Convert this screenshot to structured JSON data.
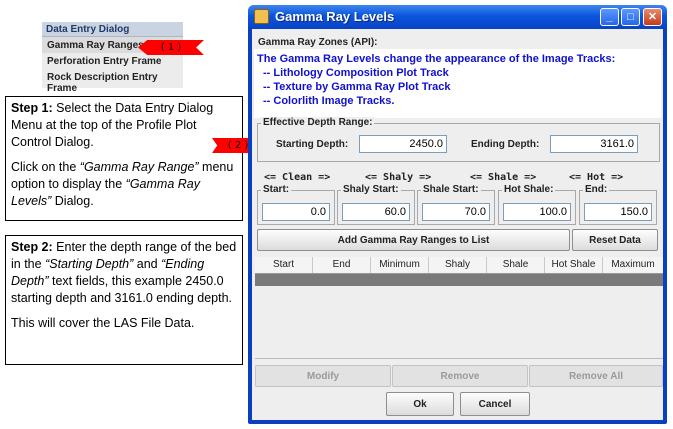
{
  "menu": {
    "header": "Data Entry Dialog",
    "items": [
      "Gamma Ray Ranges",
      "Perforation Entry Frame",
      "Rock Description Entry Frame"
    ]
  },
  "callouts": {
    "one": "( 1 )",
    "two": "( 2 )"
  },
  "step1": {
    "bold": "Step 1:",
    "text": " Select the Data Entry Dialog Menu at the top of the Profile Plot Control Dialog.",
    "p2a": "Click on the ",
    "p2i": "“Gamma Ray Range”",
    "p2b": " menu option to display the ",
    "p2i2": "“Gamma Ray Levels”",
    "p2c": " Dialog."
  },
  "step2": {
    "bold": "Step 2:",
    "a": " Enter the depth range of the bed in the ",
    "i1": "“Starting Depth”",
    "b": " and ",
    "i2": "“Ending Depth”",
    "c": " text fields, this example 2450.0 starting depth and 3161.0  ending depth.",
    "p2": "This will cover the LAS File Data."
  },
  "window": {
    "title": "Gamma Ray Levels",
    "zones": {
      "title": "Gamma Ray Zones (API):",
      "lines": [
        "The Gamma Ray Levels change the appearance of the Image Tracks:",
        "-- Lithology Composition Plot Track",
        "-- Texture by Gamma Ray Plot Track",
        "-- Colorlith Image Tracks."
      ]
    },
    "depth": {
      "title": "Effective Depth Range:",
      "start_label": "Starting Depth:",
      "start_value": "2450.0",
      "end_label": "Ending Depth:",
      "end_value": "3161.0"
    },
    "scale": [
      "<= Clean =>",
      "<= Shaly =>",
      "<= Shale =>",
      "<= Hot =>"
    ],
    "levels": [
      {
        "label": "Start:",
        "value": "0.0"
      },
      {
        "label": "Shaly Start:",
        "value": "60.0"
      },
      {
        "label": "Shale Start:",
        "value": "70.0"
      },
      {
        "label": "Hot Shale:",
        "value": "100.0"
      },
      {
        "label": "End:",
        "value": "150.0"
      }
    ],
    "buttons": {
      "add": "Add Gamma Ray Ranges to List",
      "reset": "Reset Data",
      "modify": "Modify",
      "remove": "Remove",
      "remove_all": "Remove All",
      "ok": "Ok",
      "cancel": "Cancel"
    },
    "table": {
      "columns": [
        "Start",
        "End",
        "Minimum",
        "Shaly",
        "Shale",
        "Hot Shale",
        "Maximum"
      ]
    }
  },
  "colors": {
    "callout": "#ff0000",
    "title_bar": "#0b55de",
    "zones_text": "#1010d0"
  }
}
